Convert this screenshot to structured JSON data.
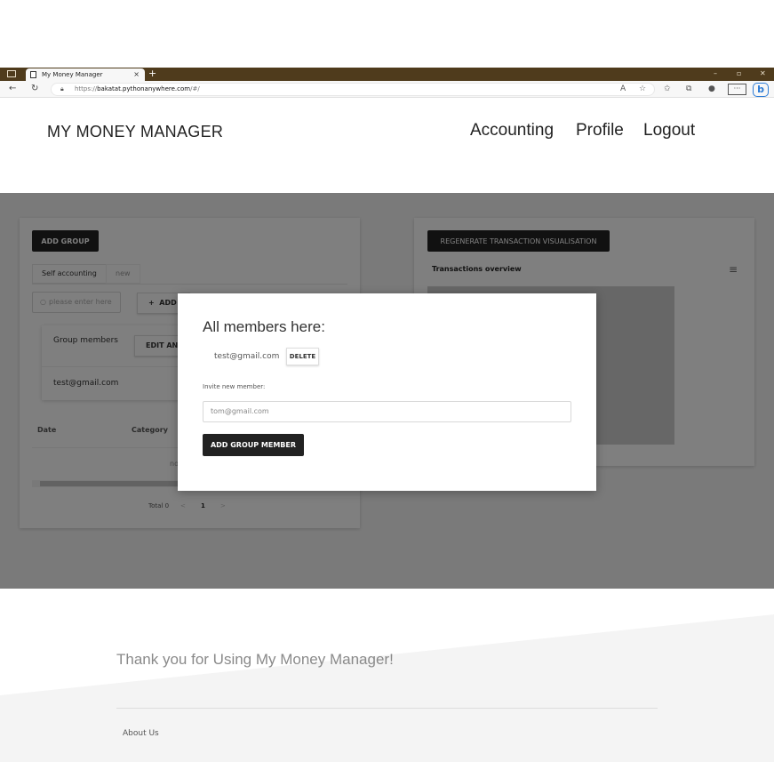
{
  "browser": {
    "tab_title": "My Money Manager",
    "tab_close": "×",
    "new_tab": "+",
    "url_prefix": "https://",
    "url_host": "bakatat.pythonanywhere.com",
    "url_path": "/#/",
    "menu": "···",
    "minimize": "–",
    "restore": "▫",
    "close": "✕"
  },
  "header": {
    "brand": "MY MONEY MANAGER",
    "nav": [
      "Accounting",
      "Profile",
      "Logout"
    ]
  },
  "left_card": {
    "add_group_label": "ADD GROUP",
    "tabs": [
      "Self accounting",
      "new"
    ],
    "search_placeholder": "please enter here",
    "add_label": "ADD",
    "members_title": "Group members",
    "edit_label": "EDIT AND",
    "member_email": "test@gmail.com",
    "col_date": "Date",
    "col_category": "Category",
    "no_data": "no",
    "pagination_total": "Total 0",
    "pagination_prev": "<",
    "pagination_page": "1",
    "pagination_next": ">"
  },
  "right_card": {
    "regen_label": "REGENERATE TRANSACTION VISUALISATION",
    "chart_title": "Transactions overview",
    "menu_icon": "≡"
  },
  "modal": {
    "title": "All members here:",
    "member_email": "test@gmail.com",
    "delete_label": "DELETE",
    "invite_label": "Invite new member:",
    "invite_placeholder": "tom@gmail.com",
    "add_member_label": "ADD GROUP MEMBER"
  },
  "footer": {
    "thanks": "Thank you for Using My Money Manager!",
    "about": "About Us"
  }
}
